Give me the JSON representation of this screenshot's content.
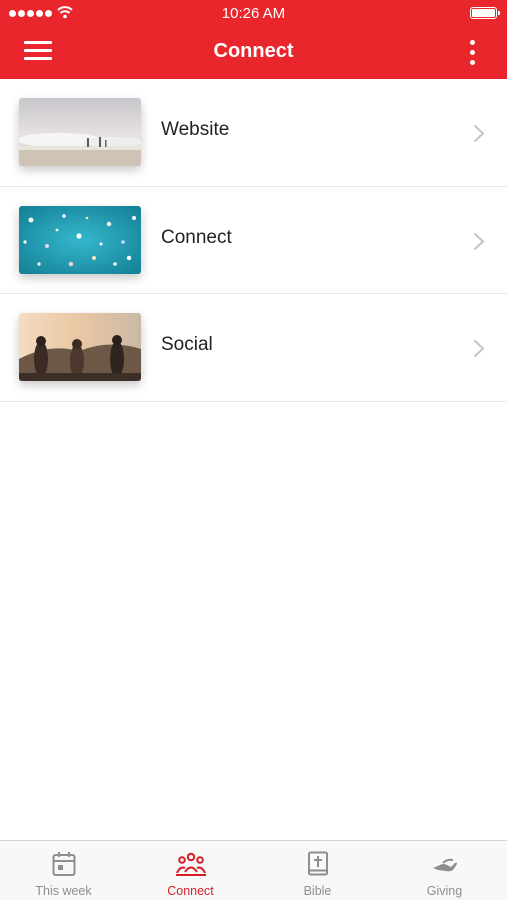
{
  "status_bar": {
    "time": "10:26 AM"
  },
  "header": {
    "title": "Connect",
    "menu_icon": "hamburger-menu-icon",
    "more_icon": "vertical-dots-icon"
  },
  "colors": {
    "accent": "#e8262b",
    "tab_active": "#d41f26",
    "tab_inactive": "#8e8e8e",
    "divider": "#e8e8e8"
  },
  "list": {
    "items": [
      {
        "label": "Website",
        "thumbnail": "beach-waves-photo",
        "icon": "chevron-right-icon"
      },
      {
        "label": "Connect",
        "thumbnail": "confetti-teal-photo",
        "icon": "chevron-right-icon"
      },
      {
        "label": "Social",
        "thumbnail": "friends-sunset-photo",
        "icon": "chevron-right-icon"
      }
    ]
  },
  "tabbar": {
    "tabs": [
      {
        "label": "This week",
        "icon": "calendar-icon",
        "active": false
      },
      {
        "label": "Connect",
        "icon": "group-people-icon",
        "active": true
      },
      {
        "label": "Bible",
        "icon": "bible-cross-icon",
        "active": false
      },
      {
        "label": "Giving",
        "icon": "giving-hand-icon",
        "active": false
      }
    ]
  }
}
